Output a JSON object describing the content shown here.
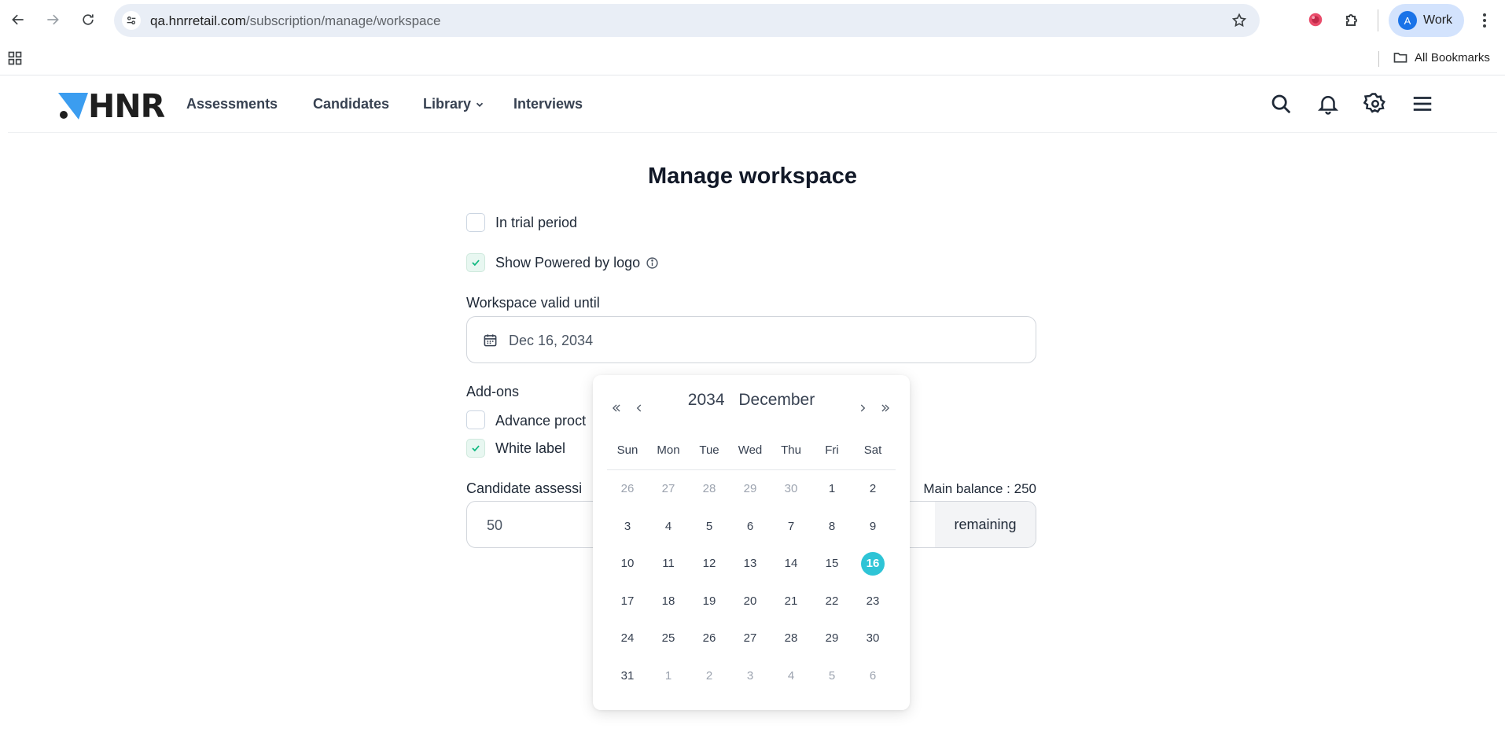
{
  "browser": {
    "url_host": "qa.hnrretail.com",
    "url_path": "/subscription/manage/workspace",
    "profile_initial": "A",
    "profile_name": "Work",
    "all_bookmarks": "All Bookmarks"
  },
  "header": {
    "logo_text": "HNR",
    "nav": [
      {
        "label": "Assessments"
      },
      {
        "label": "Candidates"
      },
      {
        "label": "Library"
      },
      {
        "label": "Interviews"
      }
    ]
  },
  "form": {
    "title": "Manage workspace",
    "in_trial_label": "In trial period",
    "in_trial_checked": false,
    "powered_by_label": "Show Powered by logo",
    "powered_by_checked": true,
    "valid_until_label": "Workspace valid until",
    "valid_until_value": "Dec 16, 2034",
    "addons_label": "Add-ons",
    "advance_label": "Advance proct",
    "advance_checked": false,
    "white_label_label": "White label",
    "white_label_checked": true,
    "candidate_label": "Candidate assessi",
    "main_balance": "Main balance : 250",
    "candidate_value": "50",
    "remaining_suffix": "remaining"
  },
  "calendar": {
    "year": "2034",
    "month": "December",
    "weekdays": [
      "Sun",
      "Mon",
      "Tue",
      "Wed",
      "Thu",
      "Fri",
      "Sat"
    ],
    "weeks": [
      [
        {
          "d": "26",
          "m": true
        },
        {
          "d": "27",
          "m": true
        },
        {
          "d": "28",
          "m": true
        },
        {
          "d": "29",
          "m": true
        },
        {
          "d": "30",
          "m": true
        },
        {
          "d": "1"
        },
        {
          "d": "2"
        }
      ],
      [
        {
          "d": "3"
        },
        {
          "d": "4"
        },
        {
          "d": "5"
        },
        {
          "d": "6"
        },
        {
          "d": "7"
        },
        {
          "d": "8"
        },
        {
          "d": "9"
        }
      ],
      [
        {
          "d": "10"
        },
        {
          "d": "11"
        },
        {
          "d": "12"
        },
        {
          "d": "13"
        },
        {
          "d": "14"
        },
        {
          "d": "15"
        },
        {
          "d": "16",
          "s": true
        }
      ],
      [
        {
          "d": "17"
        },
        {
          "d": "18"
        },
        {
          "d": "19"
        },
        {
          "d": "20"
        },
        {
          "d": "21"
        },
        {
          "d": "22"
        },
        {
          "d": "23"
        }
      ],
      [
        {
          "d": "24"
        },
        {
          "d": "25"
        },
        {
          "d": "26"
        },
        {
          "d": "27"
        },
        {
          "d": "28"
        },
        {
          "d": "29"
        },
        {
          "d": "30"
        }
      ],
      [
        {
          "d": "31"
        },
        {
          "d": "1",
          "m": true
        },
        {
          "d": "2",
          "m": true
        },
        {
          "d": "3",
          "m": true
        },
        {
          "d": "4",
          "m": true
        },
        {
          "d": "5",
          "m": true
        },
        {
          "d": "6",
          "m": true
        }
      ]
    ],
    "selected_color": "#2ec4d6"
  },
  "colors": {
    "logo_accent": "#3b9df0",
    "check_mark": "#10b981"
  }
}
